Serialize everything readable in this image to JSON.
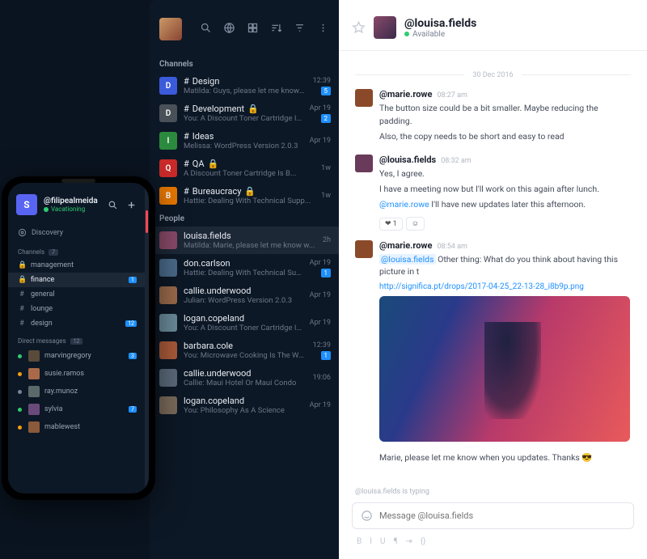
{
  "desktop": {
    "sidebar": {
      "channels_label": "Channels",
      "people_label": "People",
      "channels": [
        {
          "letter": "D",
          "color": "#3b5bdb",
          "name": "Design",
          "sub": "Matilda: Guys, please let me know wh...",
          "time": "12:39",
          "badge": "5",
          "hash": true
        },
        {
          "letter": "D",
          "color": "#495057",
          "name": "Development",
          "sub": "You: A Discount Toner Cartridge Is B...",
          "time": "Apr 19",
          "badge": "2",
          "hash": true,
          "lock": true
        },
        {
          "letter": "I",
          "color": "#2b8a3e",
          "name": "Ideas",
          "sub": "Melissa: WordPress Version 2.0.3",
          "time": "Apr 19",
          "badge": "",
          "hash": true
        },
        {
          "letter": "Q",
          "color": "#c92a2a",
          "name": "QA",
          "sub": "A Discount Toner Cartridge Is B...",
          "time": "1w",
          "badge": "",
          "hash": true,
          "lock": true
        },
        {
          "letter": "B",
          "color": "#e67700",
          "name": "Bureaucracy",
          "sub": "Hattie: Dealing With Technical Supp...",
          "time": "1w",
          "badge": "",
          "hash": true,
          "lock": true
        }
      ],
      "people": [
        {
          "name": "louisa.fields",
          "sub": "Matilda: Marie, please let me know w...",
          "time": "2h",
          "badge": "",
          "active": true,
          "color": "#8a4a6a"
        },
        {
          "name": "don.carlson",
          "sub": "Hattie: Dealing With Technical Support",
          "time": "Apr 19",
          "badge": "1",
          "color": "#4a6a8a"
        },
        {
          "name": "callie.underwood",
          "sub": "Julian: WordPress Version 2.0.3",
          "time": "Apr 19",
          "badge": "",
          "color": "#9a6a4a"
        },
        {
          "name": "logan.copeland",
          "sub": "You: A Discount Toner Cartridge Is B...",
          "time": "Apr 19",
          "badge": "",
          "color": "#6a8a9a"
        },
        {
          "name": "barbara.cole",
          "sub": "You: Microwave Cooking Is The Wav...",
          "time": "12:39",
          "badge": "1",
          "color": "#aa5a3a"
        },
        {
          "name": "callie.underwood",
          "sub": "Callie: Maui Hotel Or Maui Condo",
          "time": "19:06",
          "badge": "",
          "color": "#5a6a7a"
        },
        {
          "name": "logan.copeland",
          "sub": "You: Philosophy As A Science",
          "time": "Apr 19",
          "badge": "",
          "color": "#7a6a5a"
        }
      ]
    },
    "conversation": {
      "title": "@louisa.fields",
      "status": "Available",
      "divider_date": "30 Dec 2016",
      "messages": [
        {
          "author": "@marie.rowe",
          "time": "08:27 am",
          "avatar": "#8a4a2a",
          "lines": [
            "The button size could be a bit smaller. Maybe reducing the padding.",
            "Also, the copy needs to be short and easy to read"
          ]
        },
        {
          "author": "@louisa.fields",
          "time": "08:32 am",
          "avatar": "#6a3a5a",
          "lines": [
            "Yes, I agree.",
            "I have a meeting now but I'll work on this again after lunch."
          ],
          "mention_line": {
            "mention": "@marie.rowe",
            "rest": " I'll have new updates later this afternoon."
          },
          "reaction": {
            "emoji": "❤",
            "count": "1"
          }
        },
        {
          "author": "@marie.rowe",
          "time": "08:54 am",
          "avatar": "#8a4a2a",
          "highlight_line": {
            "mention": "@louisa.fields",
            "rest": " Other thing: What do you think about having this picture in t"
          },
          "link": "http://significa.pt/drops/2017-04-25_22-13-28_i8b9p.png",
          "has_image": true
        },
        {
          "lines": [
            "Marie, please let me know when you updates. Thanks 😎"
          ],
          "continuation": true
        }
      ],
      "typing": "@louisa.fields is typing",
      "composer_placeholder": "Message @louisa.fields",
      "format_labels": [
        "B",
        "I",
        "U",
        "¶",
        "⇥",
        "{}"
      ]
    }
  },
  "phone": {
    "user": {
      "initial": "S",
      "handle": "@filipealmeida",
      "status": "Vacationing"
    },
    "discovery_label": "Discovery",
    "channels_label": "Channels",
    "channels_count": "7",
    "channels": [
      {
        "icon": "lock",
        "name": "management",
        "badge": ""
      },
      {
        "icon": "lock",
        "name": "finance",
        "badge": "1",
        "active": true
      },
      {
        "icon": "hash",
        "name": "general",
        "badge": ""
      },
      {
        "icon": "hash",
        "name": "lounge",
        "badge": ""
      },
      {
        "icon": "hash",
        "name": "design",
        "badge": "12"
      }
    ],
    "dm_label": "Direct messages",
    "dm_count": "12",
    "dms": [
      {
        "name": "marvingregory",
        "badge": "3",
        "status": "green",
        "color": "#5a4a3a"
      },
      {
        "name": "susie.ramos",
        "badge": "",
        "status": "orange",
        "color": "#aa6a4a"
      },
      {
        "name": "ray.munoz",
        "badge": "",
        "status": "gray",
        "color": "#5a6a6a"
      },
      {
        "name": "sylvia",
        "badge": "7",
        "status": "green",
        "color": "#6a4a7a"
      },
      {
        "name": "mablewest",
        "badge": "",
        "status": "orange",
        "color": "#8a5a3a"
      }
    ]
  }
}
